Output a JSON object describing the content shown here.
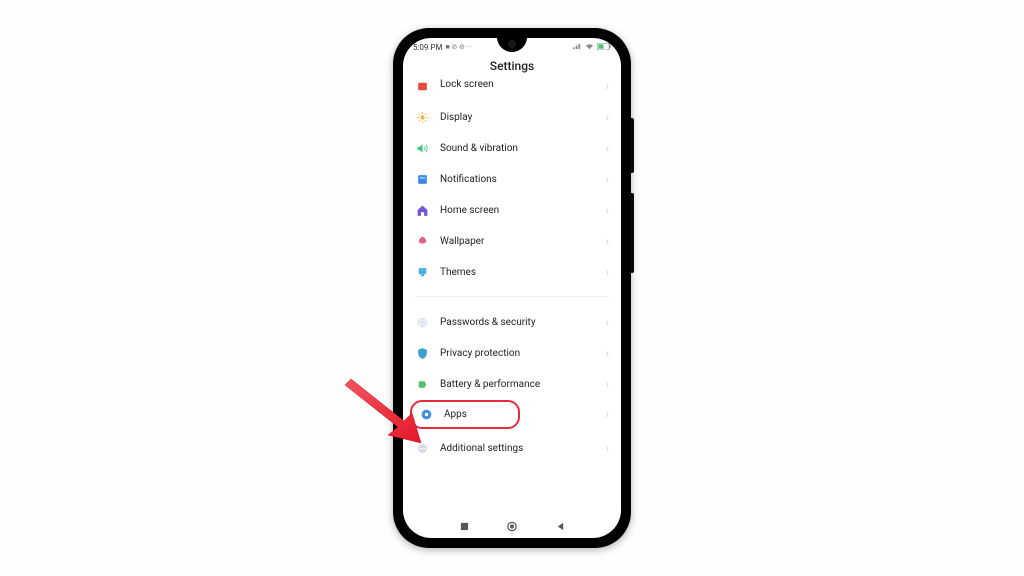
{
  "status": {
    "time": "5:09 PM",
    "indicators": "■ ⊘ ⊘ ···"
  },
  "header": {
    "title": "Settings"
  },
  "groups": [
    {
      "items": [
        {
          "id": "lock-screen",
          "iconColor": "#e84a3e",
          "label": "Lock screen"
        },
        {
          "id": "display",
          "iconColor": "#f7b733",
          "label": "Display"
        },
        {
          "id": "sound",
          "iconColor": "#3cc47c",
          "label": "Sound & vibration"
        },
        {
          "id": "notifications",
          "iconColor": "#3b8be6",
          "label": "Notifications"
        },
        {
          "id": "home-screen",
          "iconColor": "#7652d6",
          "label": "Home screen"
        },
        {
          "id": "wallpaper",
          "iconColor": "#e0638a",
          "label": "Wallpaper"
        },
        {
          "id": "themes",
          "iconColor": "#4cb0e0",
          "label": "Themes"
        }
      ]
    },
    {
      "items": [
        {
          "id": "passwords",
          "iconColor": "#b8c5e6",
          "label": "Passwords & security"
        },
        {
          "id": "privacy",
          "iconColor": "#3aa0d0",
          "label": "Privacy protection"
        },
        {
          "id": "battery",
          "iconColor": "#4fc26a",
          "label": "Battery & performance"
        },
        {
          "id": "apps",
          "iconColor": "#4a90e2",
          "label": "Apps",
          "highlighted": true
        },
        {
          "id": "additional",
          "iconColor": "#a8b4c8",
          "label": "Additional settings"
        }
      ]
    }
  ],
  "annotation": {
    "highlightColor": "#e92a3a",
    "arrowColor": "#f23847"
  }
}
